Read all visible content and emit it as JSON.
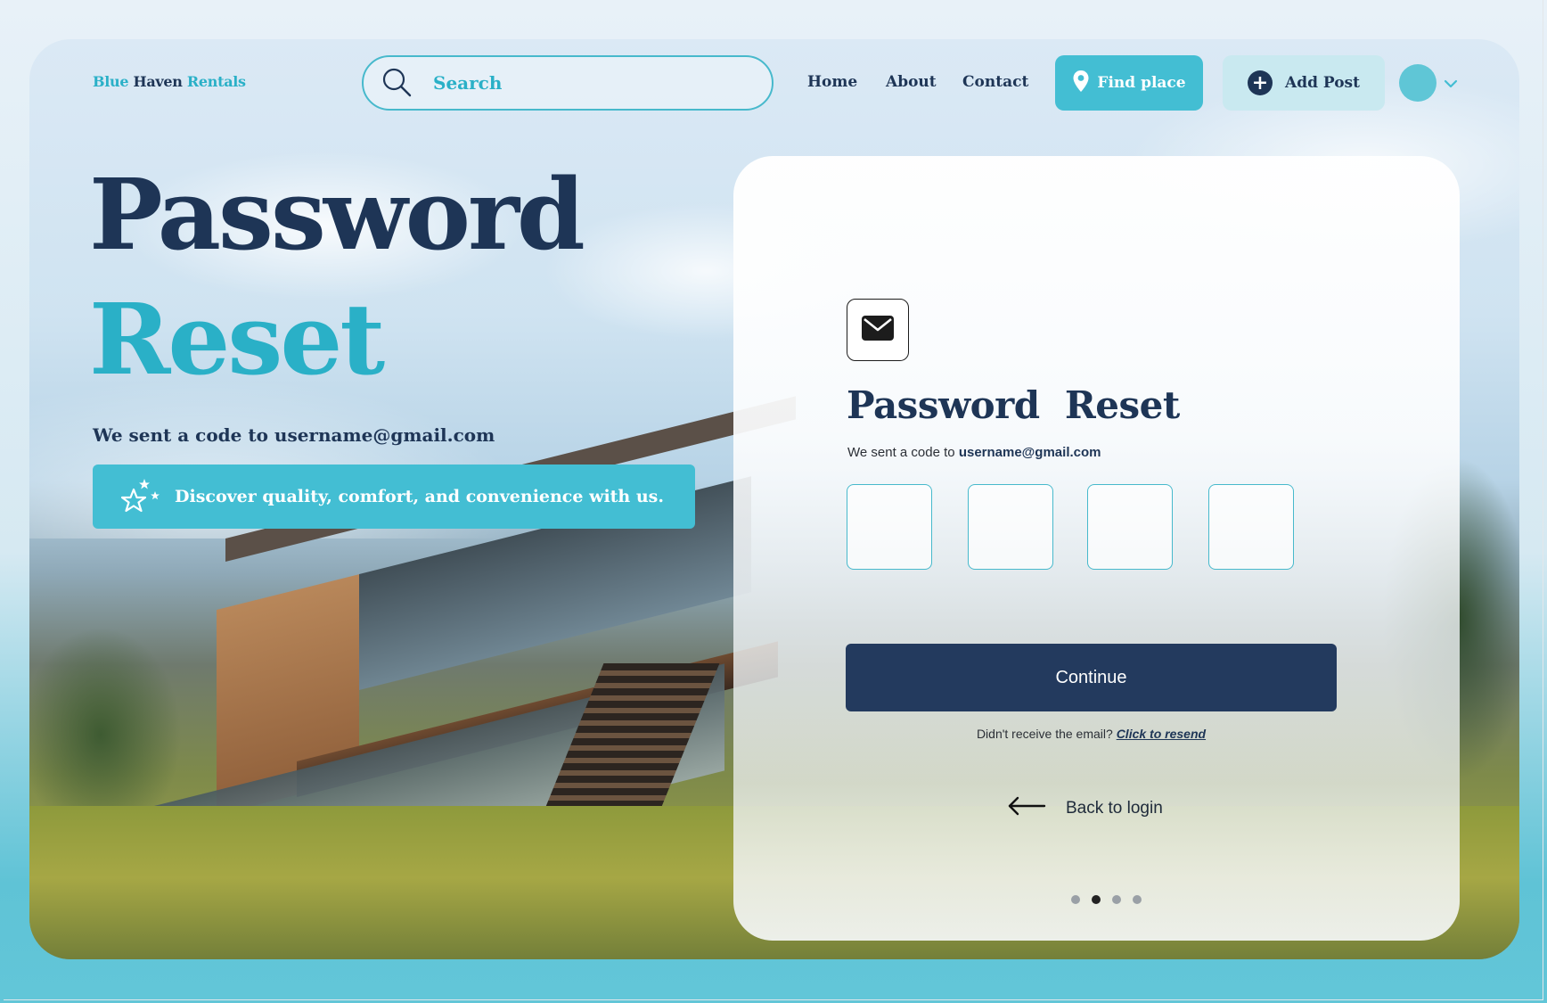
{
  "brand": {
    "part1": "Blue",
    "part2": "Haven",
    "part3": "Rentals"
  },
  "search": {
    "placeholder": "Search"
  },
  "nav": {
    "home": "Home",
    "about": "About",
    "contact": "Contact"
  },
  "actions": {
    "find_place": "Find place",
    "add_post": "Add Post"
  },
  "hero": {
    "title_line1": "Password",
    "title_line2": "Reset",
    "subtitle": "We sent a code to username@gmail.com",
    "banner": "Discover quality, comfort, and convenience with us."
  },
  "form": {
    "title_word1": "Password",
    "title_word2": "Reset",
    "subtitle_prefix": "We sent a code to",
    "email": "username@gmail.com",
    "code_digits": [
      "",
      "",
      "",
      ""
    ],
    "continue_label": "Continue",
    "resend_prompt": "Didn't receive the email?",
    "resend_link": "Click to resend",
    "back_label": "Back to login",
    "pagination": {
      "total": 4,
      "active": 2
    }
  },
  "colors": {
    "navy": "#1e3556",
    "teal": "#43bed3",
    "button": "#233a5e"
  },
  "icons": [
    "search-icon",
    "map-pin-icon",
    "plus-icon",
    "chevron-down-icon",
    "stars-icon",
    "mail-icon",
    "arrow-left-icon"
  ]
}
